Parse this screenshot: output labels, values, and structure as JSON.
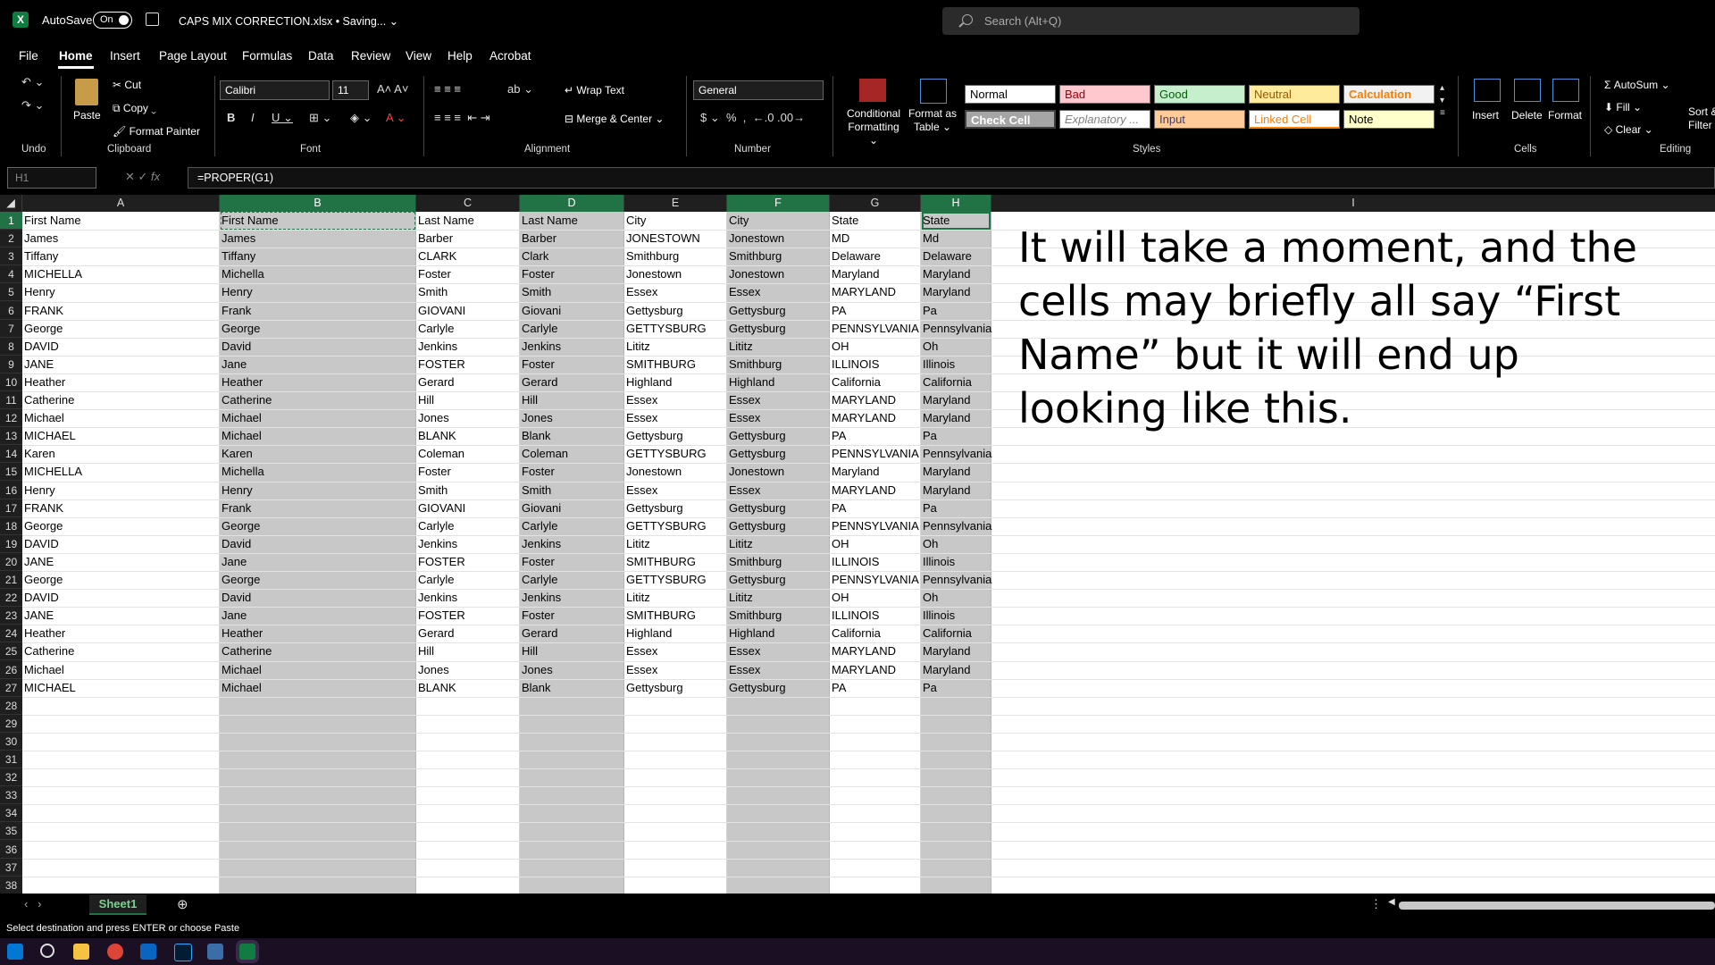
{
  "titlebar": {
    "autosave_label": "AutoSave",
    "autosave_state": "On",
    "document_title": "CAPS MIX CORRECTION.xlsx • Saving... ⌄",
    "search_placeholder": "Search (Alt+Q)"
  },
  "menu": [
    "File",
    "Home",
    "Insert",
    "Page Layout",
    "Formulas",
    "Data",
    "Review",
    "View",
    "Help",
    "Acrobat"
  ],
  "ribbon": {
    "undo_group": "Undo",
    "clipboard": {
      "paste": "Paste",
      "cut": "Cut",
      "copy": "Copy",
      "format_painter": "Format Painter",
      "label": "Clipboard"
    },
    "font": {
      "name": "Calibri",
      "size": "11",
      "label": "Font"
    },
    "alignment": {
      "wrap": "Wrap Text",
      "merge": "Merge & Center",
      "label": "Alignment"
    },
    "number": {
      "format": "General",
      "label": "Number"
    },
    "styles": {
      "conditional": "Conditional Formatting ⌄",
      "format_table": "Format as Table ⌄",
      "cells_row1": [
        "Normal",
        "Bad",
        "Good",
        "Neutral",
        "Calculation"
      ],
      "cells_row2": [
        "Check Cell",
        "Explanatory ...",
        "Input",
        "Linked Cell",
        "Note"
      ],
      "label": "Styles"
    },
    "cells": {
      "insert": "Insert",
      "delete": "Delete",
      "format": "Format",
      "label": "Cells"
    },
    "editing": {
      "autosum": "AutoSum",
      "fill": "Fill",
      "clear": "Clear",
      "sort": "Sort & Filter",
      "label": "Editing"
    }
  },
  "formula_bar": {
    "name_box": "H1",
    "formula": "=PROPER(G1)"
  },
  "columns": [
    "A",
    "B",
    "C",
    "D",
    "E",
    "F",
    "G",
    "H",
    "I"
  ],
  "row_numbers": [
    "1",
    "2",
    "3",
    "4",
    "5",
    "6",
    "7",
    "8",
    "9",
    "10",
    "11",
    "12",
    "13",
    "14",
    "15",
    "16",
    "17",
    "18",
    "19",
    "20",
    "21",
    "22",
    "23",
    "24",
    "25",
    "26",
    "27",
    "28",
    "29",
    "30",
    "31",
    "32",
    "33",
    "34",
    "35",
    "36",
    "37",
    "38"
  ],
  "rows": [
    [
      "First Name",
      "First Name",
      "Last Name",
      "Last Name",
      "City",
      "City",
      "State",
      "State"
    ],
    [
      "James",
      "James",
      "Barber",
      "Barber",
      "JONESTOWN",
      "Jonestown",
      "MD",
      "Md"
    ],
    [
      "Tiffany",
      "Tiffany",
      "CLARK",
      "Clark",
      "Smithburg",
      "Smithburg",
      "Delaware",
      "Delaware"
    ],
    [
      "MICHELLA",
      "Michella",
      "Foster",
      "Foster",
      "Jonestown",
      "Jonestown",
      "Maryland",
      "Maryland"
    ],
    [
      "Henry",
      "Henry",
      "Smith",
      "Smith",
      "Essex",
      "Essex",
      "MARYLAND",
      "Maryland"
    ],
    [
      "FRANK",
      "Frank",
      "GIOVANI",
      "Giovani",
      "Gettysburg",
      "Gettysburg",
      "PA",
      "Pa"
    ],
    [
      "George",
      "George",
      "Carlyle",
      "Carlyle",
      "GETTYSBURG",
      "Gettysburg",
      "PENNSYLVANIA",
      "Pennsylvania"
    ],
    [
      "DAVID",
      "David",
      "Jenkins",
      "Jenkins",
      "Lititz",
      "Lititz",
      "OH",
      "Oh"
    ],
    [
      "JANE",
      "Jane",
      "FOSTER",
      "Foster",
      "SMITHBURG",
      "Smithburg",
      "ILLINOIS",
      "Illinois"
    ],
    [
      "Heather",
      "Heather",
      "Gerard",
      "Gerard",
      "Highland",
      "Highland",
      "California",
      "California"
    ],
    [
      "Catherine",
      "Catherine",
      "Hill",
      "Hill",
      "Essex",
      "Essex",
      "MARYLAND",
      "Maryland"
    ],
    [
      "Michael",
      "Michael",
      "Jones",
      "Jones",
      "Essex",
      "Essex",
      "MARYLAND",
      "Maryland"
    ],
    [
      "MICHAEL",
      "Michael",
      "BLANK",
      "Blank",
      "Gettysburg",
      "Gettysburg",
      "PA",
      "Pa"
    ],
    [
      "Karen",
      "Karen",
      "Coleman",
      "Coleman",
      "GETTYSBURG",
      "Gettysburg",
      "PENNSYLVANIA",
      "Pennsylvania"
    ],
    [
      "MICHELLA",
      "Michella",
      "Foster",
      "Foster",
      "Jonestown",
      "Jonestown",
      "Maryland",
      "Maryland"
    ],
    [
      "Henry",
      "Henry",
      "Smith",
      "Smith",
      "Essex",
      "Essex",
      "MARYLAND",
      "Maryland"
    ],
    [
      "FRANK",
      "Frank",
      "GIOVANI",
      "Giovani",
      "Gettysburg",
      "Gettysburg",
      "PA",
      "Pa"
    ],
    [
      "George",
      "George",
      "Carlyle",
      "Carlyle",
      "GETTYSBURG",
      "Gettysburg",
      "PENNSYLVANIA",
      "Pennsylvania"
    ],
    [
      "DAVID",
      "David",
      "Jenkins",
      "Jenkins",
      "Lititz",
      "Lititz",
      "OH",
      "Oh"
    ],
    [
      "JANE",
      "Jane",
      "FOSTER",
      "Foster",
      "SMITHBURG",
      "Smithburg",
      "ILLINOIS",
      "Illinois"
    ],
    [
      "George",
      "George",
      "Carlyle",
      "Carlyle",
      "GETTYSBURG",
      "Gettysburg",
      "PENNSYLVANIA",
      "Pennsylvania"
    ],
    [
      "DAVID",
      "David",
      "Jenkins",
      "Jenkins",
      "Lititz",
      "Lititz",
      "OH",
      "Oh"
    ],
    [
      "JANE",
      "Jane",
      "FOSTER",
      "Foster",
      "SMITHBURG",
      "Smithburg",
      "ILLINOIS",
      "Illinois"
    ],
    [
      "Heather",
      "Heather",
      "Gerard",
      "Gerard",
      "Highland",
      "Highland",
      "California",
      "California"
    ],
    [
      "Catherine",
      "Catherine",
      "Hill",
      "Hill",
      "Essex",
      "Essex",
      "MARYLAND",
      "Maryland"
    ],
    [
      "Michael",
      "Michael",
      "Jones",
      "Jones",
      "Essex",
      "Essex",
      "MARYLAND",
      "Maryland"
    ],
    [
      "MICHAEL",
      "Michael",
      "BLANK",
      "Blank",
      "Gettysburg",
      "Gettysburg",
      "PA",
      "Pa"
    ]
  ],
  "annotation": "It will take a moment, and the cells may briefly all say “First Name” but it will end up looking like this.",
  "sheet_tab": "Sheet1",
  "status": "Select destination and press ENTER or choose Paste",
  "colors": {
    "accent": "#217346",
    "selected_column": "#c8c8c8"
  },
  "taskbar_icons": [
    "windows-icon",
    "search-icon",
    "file-explorer-icon",
    "chrome-icon",
    "outlook-icon",
    "photoshop-icon",
    "photos-icon",
    "excel-icon"
  ]
}
